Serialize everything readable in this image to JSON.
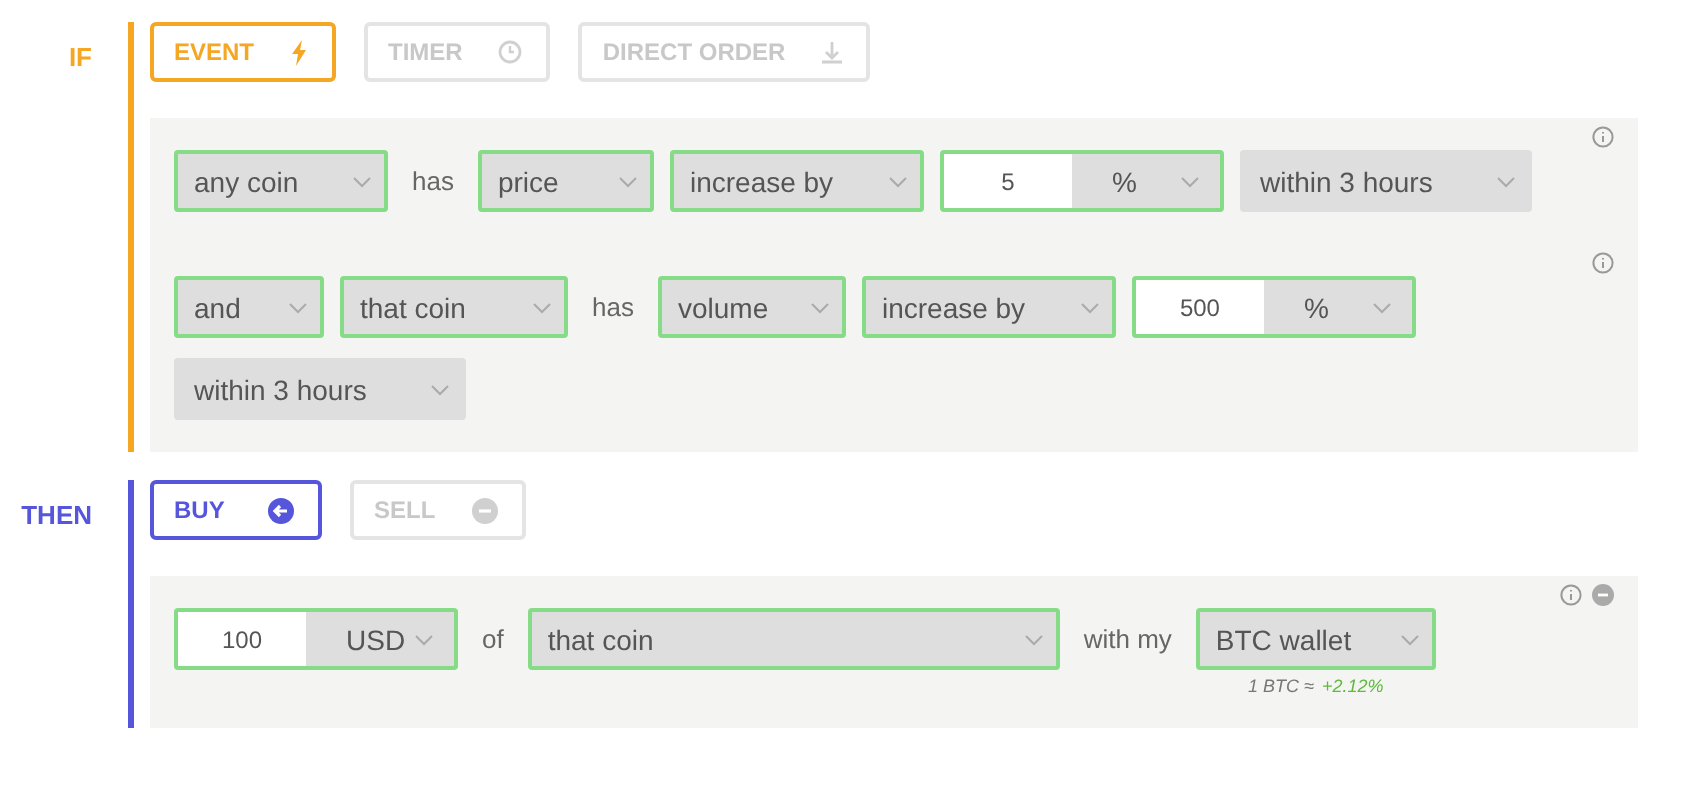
{
  "sections": [
    {
      "label": "IF",
      "color": "#f5a623",
      "modes": [
        {
          "label": "EVENT",
          "selected": true
        },
        {
          "label": "TIMER",
          "selected": false
        },
        {
          "label": "DIRECT ORDER",
          "selected": false
        }
      ],
      "rules": [
        {
          "items": [
            {
              "kind": "select",
              "text": "any coin",
              "valid": true
            },
            {
              "kind": "word",
              "text": "has"
            },
            {
              "kind": "select",
              "text": "price",
              "valid": true
            },
            {
              "kind": "select",
              "text": "increase by",
              "valid": true
            },
            {
              "kind": "amount",
              "value": "5",
              "unit": "%",
              "valid": true
            },
            {
              "kind": "select",
              "text": "within 3 hours",
              "valid": false
            }
          ],
          "info": true,
          "removable": false
        },
        {
          "items": [
            {
              "kind": "select",
              "text": "and",
              "valid": true
            },
            {
              "kind": "select",
              "text": "that coin",
              "valid": true
            },
            {
              "kind": "word",
              "text": "has"
            },
            {
              "kind": "select",
              "text": "volume",
              "valid": true
            },
            {
              "kind": "select",
              "text": "increase by",
              "valid": true
            },
            {
              "kind": "amount",
              "value": "500",
              "unit": "%",
              "valid": true
            },
            {
              "kind": "select",
              "text": "within 3 hours",
              "valid": false
            }
          ],
          "info": true,
          "removable": false
        }
      ]
    },
    {
      "label": "THEN",
      "color": "#5656dd",
      "modes": [
        {
          "label": "BUY",
          "selected": true
        },
        {
          "label": "SELL",
          "selected": false
        }
      ],
      "rules": [
        {
          "items": [
            {
              "kind": "amount",
              "value": "100",
              "unit": "USD",
              "valid": true
            },
            {
              "kind": "word",
              "text": "of"
            },
            {
              "kind": "select",
              "text": "that coin",
              "valid": true,
              "wide": true
            },
            {
              "kind": "word",
              "text": "with my"
            },
            {
              "kind": "select",
              "text": "BTC wallet",
              "valid": true,
              "note": "1 BTC ≈",
              "change": "+2.12%"
            }
          ],
          "info": true,
          "removable": true
        }
      ]
    }
  ]
}
